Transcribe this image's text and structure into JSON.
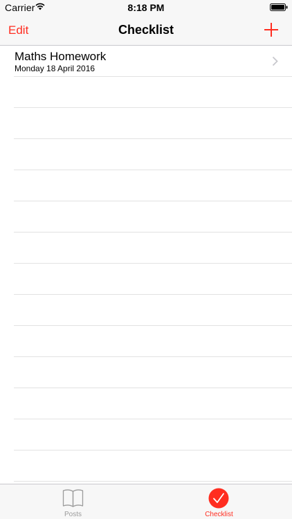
{
  "status_bar": {
    "carrier": "Carrier",
    "time": "8:18 PM"
  },
  "nav": {
    "edit_label": "Edit",
    "title": "Checklist"
  },
  "list": {
    "items": [
      {
        "title": "Maths Homework",
        "subtitle": "Monday 18 April 2016"
      }
    ],
    "empty_rows": 13
  },
  "tabs": [
    {
      "label": "Posts",
      "icon": "book-icon",
      "selected": false
    },
    {
      "label": "Checklist",
      "icon": "check-circle-icon",
      "selected": true
    }
  ],
  "colors": {
    "accent": "#ff2d20",
    "inactive": "#9b9b9b",
    "bar_background": "#f7f7f7"
  }
}
